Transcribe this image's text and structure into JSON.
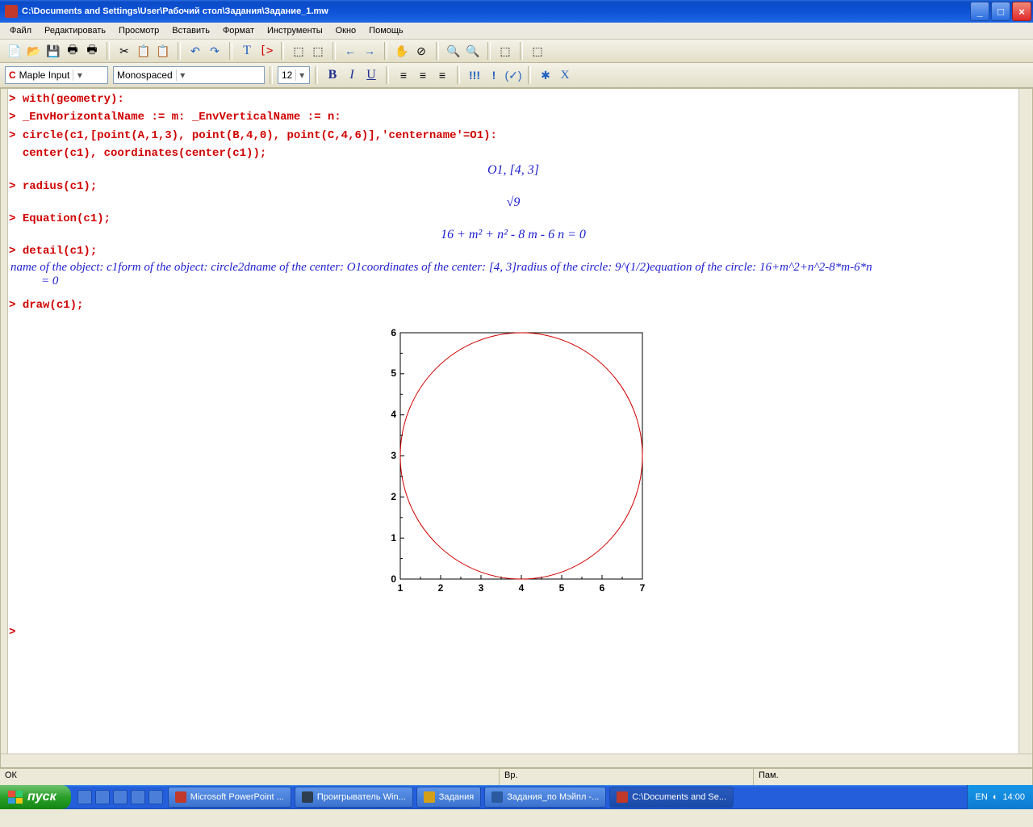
{
  "title": "C:\\Documents and Settings\\User\\Рабочий стол\\Задания\\Задание_1.mw",
  "menu": [
    "Файл",
    "Редактировать",
    "Просмотр",
    "Вставить",
    "Формат",
    "Инструменты",
    "Окно",
    "Помощь"
  ],
  "combo_style": "Maple Input",
  "combo_font": "Monospaced",
  "combo_size": "12",
  "code": {
    "l1": "with(geometry):",
    "l2": "_EnvHorizontalName := m: _EnvVerticalName := n:",
    "l3a": "circle(c1,[point(A,1,3), point(B,4,0), point(C,4,6)],'centername'=O1):",
    "l3b": "center(c1), coordinates(center(c1));",
    "out1": "O1, [4, 3]",
    "l4": "radius(c1);",
    "out2": "√9",
    "l5": "Equation(c1);",
    "out3": "16 + m² + n² - 8 m - 6 n = 0",
    "l6": "detail(c1);",
    "out4a": "name of the object:  c1form of the object:  circle2dname of the center:  O1coordinates of the center:  [4, 3]radius of the circle:  9^(1/2)equation of the circle:  16+m^2+n^2-8*m-6*n",
    "out4b": "= 0",
    "l7": "draw(c1);"
  },
  "chart_data": {
    "type": "line",
    "title": "",
    "object": "circle",
    "center": [
      4,
      3
    ],
    "radius": 3,
    "xlim": [
      1,
      7
    ],
    "ylim": [
      0,
      6
    ],
    "xticks": [
      1,
      2,
      3,
      4,
      5,
      6,
      7
    ],
    "yticks": [
      0,
      1,
      2,
      3,
      4,
      5,
      6
    ],
    "xlabel": "",
    "ylabel": "",
    "series": [
      {
        "name": "c1",
        "color": "#d00000",
        "equation": "(m-4)^2+(n-3)^2=9"
      }
    ]
  },
  "status": {
    "s1": "ОК",
    "s2": "Вр.",
    "s3": "Пам."
  },
  "start": "пуск",
  "tasks": [
    {
      "label": "Microsoft PowerPoint ...",
      "icon": "#d35400"
    },
    {
      "label": "Проигрыватель Win...",
      "icon": "#2c3e50"
    },
    {
      "label": "Задания",
      "icon": "#d4a017"
    },
    {
      "label": "Задания_по Мэйпл -...",
      "icon": "#2c5aa0"
    },
    {
      "label": "C:\\Documents and Se...",
      "icon": "#c0392b"
    }
  ],
  "tray": {
    "lang": "EN",
    "time": "14:00"
  }
}
